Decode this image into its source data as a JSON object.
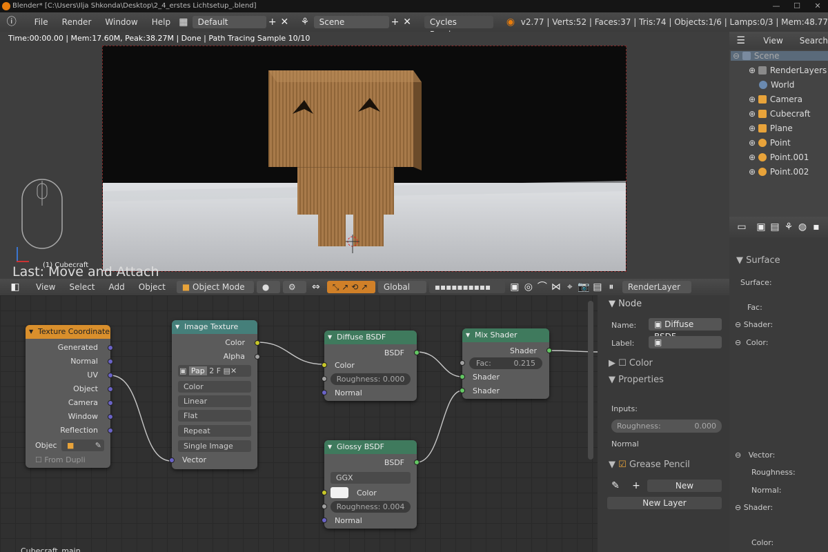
{
  "titlebar": {
    "title": "Blender* [C:\\Users\\Ilja Shkonda\\Desktop\\2_4_erstes Lichtsetup_.blend]"
  },
  "menubar": {
    "menus": [
      "File",
      "Render",
      "Window",
      "Help"
    ],
    "layout": "Default",
    "scene": "Scene",
    "engine": "Cycles Render",
    "stats": "v2.77 | Verts:52 | Faces:37 | Tris:74 | Objects:1/6 | Lamps:0/3 | Mem:48.77"
  },
  "viewport": {
    "info": "Time:00:00.00 | Mem:17.60M, Peak:38.27M | Done | Path Tracing Sample 10/10",
    "last_op": "Last: Move and Attach",
    "object_label": "(1) Cubecraft"
  },
  "viewport_header": {
    "menus": [
      "View",
      "Select",
      "Add",
      "Object"
    ],
    "mode": "Object Mode",
    "orientation": "Global",
    "render_layer": "RenderLayer"
  },
  "nodes": {
    "texcoord": {
      "title": "Texture Coordinate",
      "outputs": [
        "Generated",
        "Normal",
        "UV",
        "Object",
        "Camera",
        "Window",
        "Reflection"
      ],
      "object_label": "Objec",
      "from_dupli": "From Dupli"
    },
    "imgtex": {
      "title": "Image Texture",
      "outputs": [
        "Color",
        "Alpha"
      ],
      "img_name": "Pap",
      "img_users": "2",
      "img_fake": "F",
      "color_space": "Color",
      "interpolation": "Linear",
      "projection": "Flat",
      "extension": "Repeat",
      "source": "Single Image",
      "input": "Vector"
    },
    "diffuse": {
      "title": "Diffuse BSDF",
      "output": "BSDF",
      "color": "Color",
      "roughness": "Roughness: 0.000",
      "normal": "Normal"
    },
    "glossy": {
      "title": "Glossy BSDF",
      "output": "BSDF",
      "distribution": "GGX",
      "color": "Color",
      "roughness": "Roughness: 0.004",
      "normal": "Normal"
    },
    "mix": {
      "title": "Mix Shader",
      "output": "Shader",
      "fac_label": "Fac:",
      "fac_value": "0.215",
      "in1": "Shader",
      "in2": "Shader"
    }
  },
  "node_status": "Cubecraft_main",
  "sidepanel": {
    "node_header": "Node",
    "name_label": "Name:",
    "name_value": "Diffuse BSDF",
    "label_label": "Label:",
    "color_header": "Color",
    "properties_header": "Properties",
    "inputs_label": "Inputs:",
    "roughness_label": "Roughness:",
    "roughness_value": "0.000",
    "normal_label": "Normal",
    "grease_header": "Grease Pencil",
    "new_btn": "New",
    "new_layer_btn": "New Layer"
  },
  "outliner": {
    "header": [
      "View",
      "Search"
    ],
    "items": [
      "Scene",
      "RenderLayers",
      "World",
      "Camera",
      "Cubecraft",
      "Plane",
      "Point",
      "Point.001",
      "Point.002"
    ]
  },
  "properties": {
    "surface_header": "Surface",
    "surface_label": "Surface:",
    "fac": "Fac:",
    "shader1": "Shader:",
    "color1": "Color:",
    "vector": "Vector:",
    "roughness": "Roughness:",
    "normal": "Normal:",
    "shader2": "Shader:",
    "color2": "Color:"
  },
  "colors": {
    "accent": "#e87d0d",
    "node_input": "#d98f2c",
    "node_texture": "#457f7a",
    "node_shader": "#3f7a5d"
  }
}
